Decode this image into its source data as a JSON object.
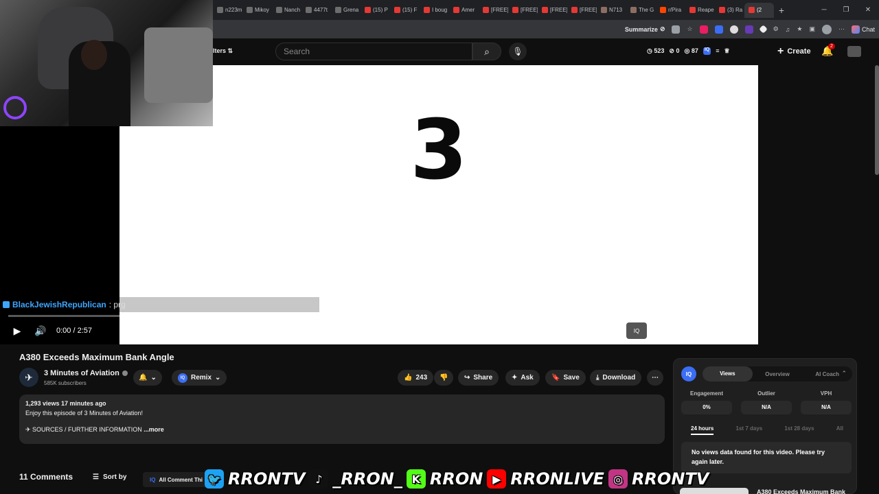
{
  "browser": {
    "tabs": [
      {
        "label": "n223m",
        "color": "#6d6d6d"
      },
      {
        "label": "Mikoy",
        "color": "#6d6d6d"
      },
      {
        "label": "Nanch",
        "color": "#6d6d6d"
      },
      {
        "label": "4477t",
        "color": "#6d6d6d"
      },
      {
        "label": "Grena",
        "color": "#6d6d6d"
      },
      {
        "label": "(15) P",
        "color": "#e53935"
      },
      {
        "label": "(15) F",
        "color": "#e53935"
      },
      {
        "label": "I boug",
        "color": "#e53935"
      },
      {
        "label": "Amer",
        "color": "#e53935"
      },
      {
        "label": "[FREE]",
        "color": "#e53935"
      },
      {
        "label": "[FREE]",
        "color": "#e53935"
      },
      {
        "label": "[FREE]",
        "color": "#e53935"
      },
      {
        "label": "[FREE]",
        "color": "#e53935"
      },
      {
        "label": "N713",
        "color": "#8d6e63"
      },
      {
        "label": "The G",
        "color": "#8d6e63"
      },
      {
        "label": "r/Pira",
        "color": "#ff4500"
      },
      {
        "label": "Reape",
        "color": "#e53935"
      },
      {
        "label": "(3) Ra",
        "color": "#e53935"
      },
      {
        "label": "(2",
        "color": "#e53935"
      }
    ],
    "summarize_label": "Summarize",
    "chat_label": "Chat"
  },
  "yt_header": {
    "filters_label": "lters",
    "search_placeholder": "Search",
    "stat_views": "523",
    "stat_zero": "0",
    "stat_eighty": "87",
    "iq_label": "IQ",
    "create_label": "Create",
    "notification_count": "2"
  },
  "player": {
    "countdown_digit": "3",
    "chat_user": "BlackJewishRepublican",
    "chat_message": " : prg",
    "time": "0:00 / 2:57",
    "iq_label": "IQ"
  },
  "video": {
    "title": "A380 Exceeds Maximum Bank Angle",
    "channel_name": "3 Minutes of Aviation",
    "subscribers": "585K subscribers",
    "remix_label": "Remix",
    "likes": "243",
    "share_label": "Share",
    "ask_label": "Ask",
    "save_label": "Save",
    "download_label": "Download",
    "views_and_date": "1,293 views  17 minutes ago",
    "description_line": "Enjoy this episode of 3 Minutes of Aviation!",
    "sources_line": "✈ SOURCES / FURTHER INFORMATION",
    "more_label": " ...more"
  },
  "comments": {
    "count_label": "11 Comments",
    "sort_label": "Sort by",
    "all_comment_label": "All Comment Thi"
  },
  "panel": {
    "iq_label": "IQ",
    "tabs": [
      "Views",
      "Overview",
      "AI Coach"
    ],
    "metrics": [
      {
        "label": "Engagement",
        "value": "0%"
      },
      {
        "label": "Outlier",
        "value": "N/A"
      },
      {
        "label": "VPH",
        "value": "N/A"
      }
    ],
    "ranges": [
      "24 hours",
      "1st 7 days",
      "1st 28 days",
      "All"
    ],
    "no_data_message": "No views data found for this video. Please try again later.",
    "rec_title": "A380 Exceeds Maximum Bank"
  },
  "overlay": {
    "handles": [
      {
        "label": "RRONTV",
        "icon": "twitter-icon",
        "color": "#1da1f2"
      },
      {
        "label": "_RRON_",
        "icon": "tiktok-icon",
        "color": "#111111"
      },
      {
        "label": "RRON",
        "icon": "kick-icon",
        "color": "#53fc18"
      },
      {
        "label": "RRONLIVE",
        "icon": "youtube-icon",
        "color": "#ff0000"
      },
      {
        "label": "RRONTV",
        "icon": "instagram-icon",
        "color": "#c13584"
      }
    ]
  },
  "colors": {
    "youtube_red": "#ff0000",
    "iq_blue": "#3b6ef5",
    "chat_blue": "#3ea6ff"
  }
}
